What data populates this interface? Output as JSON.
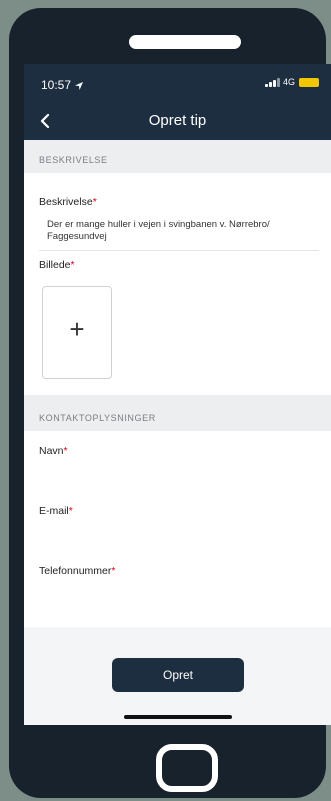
{
  "status": {
    "time": "10:57",
    "network": "4G",
    "battery": ""
  },
  "nav": {
    "title": "Opret tip"
  },
  "description_section": {
    "header": "BESKRIVELSE",
    "description_label": "Beskrivelse",
    "description_value": "Der er mange huller i vejen i svingbanen v. Nørrebro/ Faggesundvej",
    "image_label": "Billede",
    "add_image_glyph": "+"
  },
  "contact_section": {
    "header": "KONTAKTOPLYSNINGER",
    "name_label": "Navn",
    "email_label": "E-mail",
    "phone_label": "Telefonnummer"
  },
  "required_marker": "*",
  "submit_label": "Opret",
  "colors": {
    "primary": "#1d2e40",
    "required": "#d0021b",
    "battery": "#f2c700",
    "frame": "#18222d"
  }
}
